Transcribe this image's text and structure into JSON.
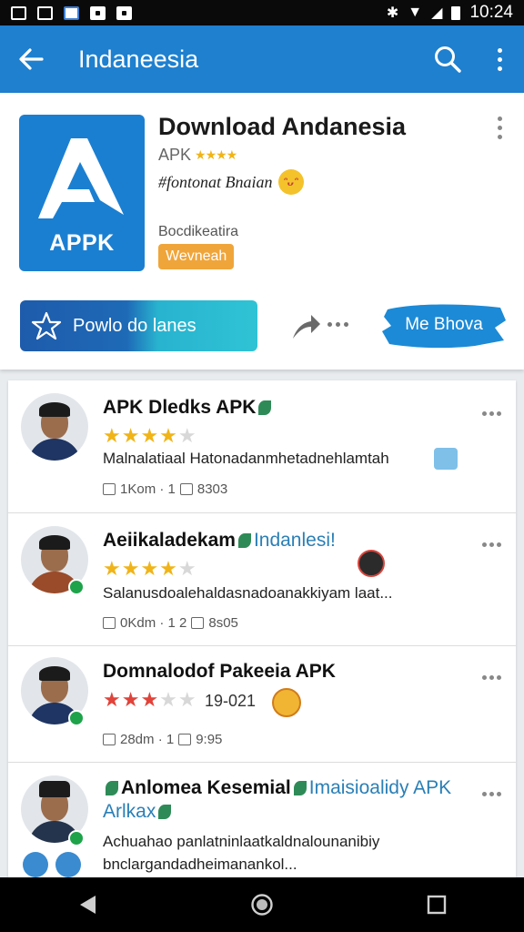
{
  "statusbar": {
    "time": "10:24"
  },
  "appbar": {
    "title": "Indaneesia"
  },
  "app": {
    "title": "Download Andanesia",
    "subtitle": "APK",
    "stars": "★★★★",
    "tagline": "#fontonat Bnaian",
    "category": "Bocdikeatira",
    "badge": "Wevneah",
    "icon_label": "APPK",
    "download_label": "Powlo do lanes",
    "secondary_label": "Me Bhova",
    "colors": {
      "appbar": "#1e80cf",
      "download_start": "#1e5bab",
      "download_end": "#2fc3d5",
      "badge": "#f0a53a",
      "brush": "#1c8ad6"
    }
  },
  "posts": [
    {
      "title": "APK Dledks APK",
      "rating": 4,
      "text": "Malnalatiaal Hatonadanmhetadnehlamtah",
      "meta": "1Kom · 1",
      "meta2": "8303"
    },
    {
      "title": "Aeiikaladekam",
      "highlight": "Indanlesi!",
      "rating": 4,
      "text": "Salanusdoalehaldasnadoanakkiyam laat...",
      "meta": "0Kdm · 1 2",
      "meta2": "8s05"
    },
    {
      "title": "Domnalodof Pakeeia APK",
      "rating": 3,
      "date": "19-021",
      "meta": "28dm · 1",
      "meta2": "9:95"
    },
    {
      "title": "Anlomea Kesemial",
      "highlight": "Imaisioalidy APK",
      "title_line2": "Arlkax",
      "text": "Achuahao panlatninlaatkaldnalounanibiy bnclargandadheimanankol..."
    }
  ]
}
